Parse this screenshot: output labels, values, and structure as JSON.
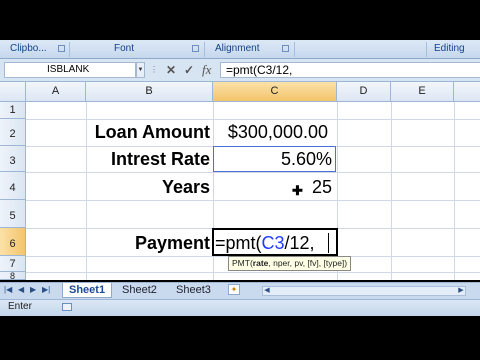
{
  "ribbon": {
    "groups": [
      "Clipbo...",
      "Font",
      "Alignment",
      "Editing"
    ]
  },
  "formula_bar": {
    "name_box": "ISBLANK",
    "cancel_icon": "✕",
    "enter_icon": "✓",
    "fx_label": "fx",
    "formula": "=pmt(C3/12,"
  },
  "columns": [
    "A",
    "B",
    "C",
    "D",
    "E"
  ],
  "rows": [
    "1",
    "2",
    "3",
    "4",
    "5",
    "6",
    "7",
    "8"
  ],
  "cells": {
    "b2": "Loan Amount",
    "c2": "$300,000.00",
    "b3": "Intrest Rate",
    "c3": "5.60%",
    "b4": "Years",
    "c4": "25",
    "b6": "Payment",
    "c6_prefix": "=pmt(",
    "c6_ref": "C3",
    "c6_suffix": "/12,"
  },
  "tooltip": {
    "func": "PMT(",
    "rate": "rate",
    "rest": ", nper, pv, [fv], [type])"
  },
  "sheet_tabs": [
    "Sheet1",
    "Sheet2",
    "Sheet3"
  ],
  "status": {
    "mode": "Enter"
  },
  "colors": {
    "ref_blue": "#1f3cff",
    "header_selected": "#f3c46b",
    "ribbon_text": "#15428b"
  }
}
